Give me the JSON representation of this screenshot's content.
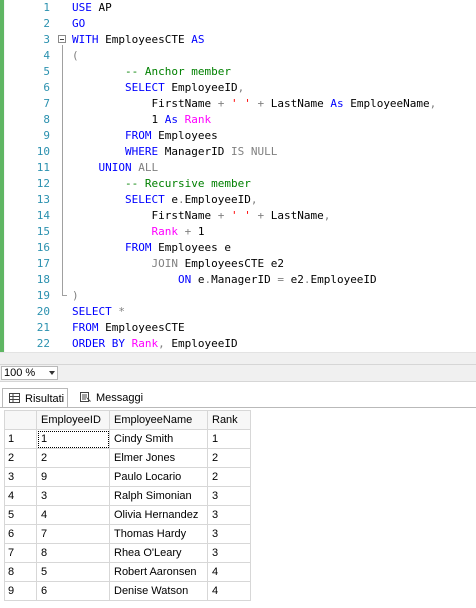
{
  "editor": {
    "lines": [
      {
        "n": "1",
        "indent": "",
        "tokens": [
          {
            "t": "USE",
            "c": "kw"
          },
          {
            "t": " AP",
            "c": "pl"
          }
        ]
      },
      {
        "n": "2",
        "indent": "",
        "tokens": [
          {
            "t": "GO",
            "c": "kw"
          }
        ]
      },
      {
        "n": "3",
        "indent": "",
        "tokens": [
          {
            "t": "WITH",
            "c": "kw"
          },
          {
            "t": " EmployeesCTE ",
            "c": "pl"
          },
          {
            "t": "AS",
            "c": "kw"
          }
        ]
      },
      {
        "n": "4",
        "indent": "",
        "tokens": [
          {
            "t": "(",
            "c": "gr"
          }
        ]
      },
      {
        "n": "5",
        "indent": "        ",
        "tokens": [
          {
            "t": "-- Anchor member",
            "c": "cm"
          }
        ]
      },
      {
        "n": "6",
        "indent": "        ",
        "tokens": [
          {
            "t": "SELECT",
            "c": "kw"
          },
          {
            "t": " EmployeeID",
            "c": "pl"
          },
          {
            "t": ",",
            "c": "gr"
          }
        ]
      },
      {
        "n": "7",
        "indent": "            ",
        "tokens": [
          {
            "t": "FirstName ",
            "c": "pl"
          },
          {
            "t": "+",
            "c": "gr"
          },
          {
            "t": " ",
            "c": "pl"
          },
          {
            "t": "' '",
            "c": "str"
          },
          {
            "t": " ",
            "c": "pl"
          },
          {
            "t": "+",
            "c": "gr"
          },
          {
            "t": " LastName ",
            "c": "pl"
          },
          {
            "t": "As",
            "c": "kw"
          },
          {
            "t": " EmployeeName",
            "c": "pl"
          },
          {
            "t": ",",
            "c": "gr"
          }
        ]
      },
      {
        "n": "8",
        "indent": "            ",
        "tokens": [
          {
            "t": "1 ",
            "c": "pl"
          },
          {
            "t": "As",
            "c": "kw"
          },
          {
            "t": " ",
            "c": "pl"
          },
          {
            "t": "Rank",
            "c": "fn"
          }
        ]
      },
      {
        "n": "9",
        "indent": "        ",
        "tokens": [
          {
            "t": "FROM",
            "c": "kw"
          },
          {
            "t": " Employees",
            "c": "pl"
          }
        ]
      },
      {
        "n": "10",
        "indent": "        ",
        "tokens": [
          {
            "t": "WHERE",
            "c": "kw"
          },
          {
            "t": " ManagerID ",
            "c": "pl"
          },
          {
            "t": "IS NULL",
            "c": "gr"
          }
        ]
      },
      {
        "n": "11",
        "indent": "    ",
        "tokens": [
          {
            "t": "UNION",
            "c": "kw"
          },
          {
            "t": " ALL",
            "c": "gr"
          }
        ]
      },
      {
        "n": "12",
        "indent": "        ",
        "tokens": [
          {
            "t": "-- Recursive member",
            "c": "cm"
          }
        ]
      },
      {
        "n": "13",
        "indent": "        ",
        "tokens": [
          {
            "t": "SELECT",
            "c": "kw"
          },
          {
            "t": " e",
            "c": "pl"
          },
          {
            "t": ".",
            "c": "gr"
          },
          {
            "t": "EmployeeID",
            "c": "pl"
          },
          {
            "t": ",",
            "c": "gr"
          }
        ]
      },
      {
        "n": "14",
        "indent": "            ",
        "tokens": [
          {
            "t": "FirstName ",
            "c": "pl"
          },
          {
            "t": "+",
            "c": "gr"
          },
          {
            "t": " ",
            "c": "pl"
          },
          {
            "t": "' '",
            "c": "str"
          },
          {
            "t": " ",
            "c": "pl"
          },
          {
            "t": "+",
            "c": "gr"
          },
          {
            "t": " LastName",
            "c": "pl"
          },
          {
            "t": ",",
            "c": "gr"
          }
        ]
      },
      {
        "n": "15",
        "indent": "            ",
        "tokens": [
          {
            "t": "Rank",
            "c": "fn"
          },
          {
            "t": " ",
            "c": "pl"
          },
          {
            "t": "+",
            "c": "gr"
          },
          {
            "t": " 1",
            "c": "pl"
          }
        ]
      },
      {
        "n": "16",
        "indent": "        ",
        "tokens": [
          {
            "t": "FROM",
            "c": "kw"
          },
          {
            "t": " Employees e",
            "c": "pl"
          }
        ]
      },
      {
        "n": "17",
        "indent": "            ",
        "tokens": [
          {
            "t": "JOIN",
            "c": "gr"
          },
          {
            "t": " EmployeesCTE e2",
            "c": "pl"
          }
        ]
      },
      {
        "n": "18",
        "indent": "                ",
        "tokens": [
          {
            "t": "ON",
            "c": "kw"
          },
          {
            "t": " e",
            "c": "pl"
          },
          {
            "t": ".",
            "c": "gr"
          },
          {
            "t": "ManagerID ",
            "c": "pl"
          },
          {
            "t": "=",
            "c": "gr"
          },
          {
            "t": " e2",
            "c": "pl"
          },
          {
            "t": ".",
            "c": "gr"
          },
          {
            "t": "EmployeeID",
            "c": "pl"
          }
        ]
      },
      {
        "n": "19",
        "indent": "",
        "tokens": [
          {
            "t": ")",
            "c": "gr"
          }
        ]
      },
      {
        "n": "20",
        "indent": "",
        "tokens": [
          {
            "t": "SELECT",
            "c": "kw"
          },
          {
            "t": " ",
            "c": "pl"
          },
          {
            "t": "*",
            "c": "gr"
          }
        ]
      },
      {
        "n": "21",
        "indent": "",
        "tokens": [
          {
            "t": "FROM",
            "c": "kw"
          },
          {
            "t": " EmployeesCTE",
            "c": "pl"
          }
        ]
      },
      {
        "n": "22",
        "indent": "",
        "tokens": [
          {
            "t": "ORDER BY",
            "c": "kw"
          },
          {
            "t": " ",
            "c": "pl"
          },
          {
            "t": "Rank",
            "c": "fn"
          },
          {
            "t": ",",
            "c": "gr"
          },
          {
            "t": " EmployeeID",
            "c": "pl"
          }
        ]
      }
    ]
  },
  "zoom": {
    "value": "100 %"
  },
  "tabs": [
    {
      "label": "Risultati",
      "icon": "grid-icon",
      "active": true
    },
    {
      "label": "Messaggi",
      "icon": "messages-icon",
      "active": false
    }
  ],
  "results": {
    "columns": [
      "",
      "EmployeeID",
      "EmployeeName",
      "Rank"
    ],
    "rows": [
      [
        "1",
        "1",
        "Cindy Smith",
        "1"
      ],
      [
        "2",
        "2",
        "Elmer Jones",
        "2"
      ],
      [
        "3",
        "9",
        "Paulo Locario",
        "2"
      ],
      [
        "4",
        "3",
        "Ralph Simonian",
        "3"
      ],
      [
        "5",
        "4",
        "Olivia Hernandez",
        "3"
      ],
      [
        "6",
        "7",
        "Thomas Hardy",
        "3"
      ],
      [
        "7",
        "8",
        "Rhea O'Leary",
        "3"
      ],
      [
        "8",
        "5",
        "Robert Aaronsen",
        "4"
      ],
      [
        "9",
        "6",
        "Denise Watson",
        "4"
      ]
    ]
  },
  "colors": {
    "keyword": "#0000ff",
    "comment": "#008000",
    "string": "#ff0000",
    "function": "#ff00ff",
    "operator": "#808080",
    "line_number": "#2b91af"
  }
}
